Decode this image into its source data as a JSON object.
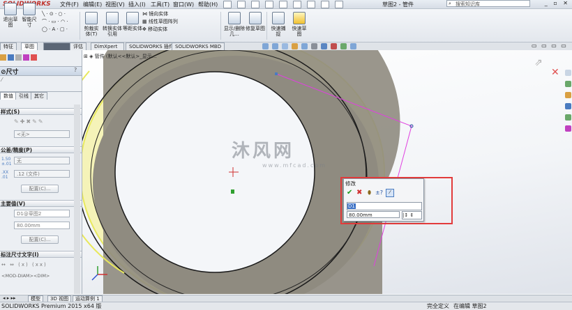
{
  "app": {
    "logo": "SOLIDWORKS",
    "doc_title": "草图2 - 管件",
    "search_placeholder": "搜索知识库",
    "window_controls": "_ ▫ ✕"
  },
  "menu": [
    "文件(F)",
    "编辑(E)",
    "视图(V)",
    "插入(I)",
    "工具(T)",
    "窗口(W)",
    "帮助(H)"
  ],
  "ribbon": {
    "exit_sketch": "退出草图",
    "smart_dim": "智能尺寸",
    "trim": "剪裁实体(T)",
    "convert": "转换实体引用",
    "offset": "等距实体",
    "mirror": "镜向实体",
    "linear_pattern": "线性草图阵列",
    "move": "移动实体",
    "display_relations": "显示/删除几...",
    "repair": "修复草图",
    "quick_snaps": "快速捕捉",
    "rapid_sketch": "快速草图"
  },
  "tabs": [
    "特征",
    "草图",
    "评估",
    "DimXpert",
    "SOLIDWORKS 插件",
    "SOLIDWORKS MBD"
  ],
  "tree_header": "管件 (默认<<默认>_显示...",
  "panel": {
    "title": "尺寸",
    "help": "?",
    "subtabs": [
      "数值",
      "引线",
      "其它"
    ],
    "style_header": "样式(S)",
    "style_value": "<无>",
    "tolerance_header": "公差/精度(P)",
    "tol_type": "无",
    "precision": ".12 (文件)",
    "config_button": "配置(C)...",
    "primary_header": "主要值(V)",
    "primary_name": "D1@草图2",
    "primary_value": "80.00mm",
    "config_button2": "配置(C)...",
    "dimtext_header": "标注尺寸文字(I)",
    "dimtext_value": "<MOD-DIAM><DIM>"
  },
  "modify": {
    "title": "修改",
    "name": "D1",
    "value": "80.00mm"
  },
  "watermark": {
    "main": "沐风网",
    "sub": "www.mfcad.com"
  },
  "bottom_tabs": [
    "模型",
    "3D 视图",
    "运动算例 1"
  ],
  "status": {
    "product": "SOLIDWORKS Premium 2015 x64 版",
    "state": "完全定义",
    "editing": "在编辑 草图2"
  },
  "colors": {
    "ring_fill": "#f5f3b8",
    "ring_edge": "#e8e85c",
    "ring_dark": "#8f8b80",
    "sketch_line": "#e040e0",
    "red_highlight": "#e23b3b",
    "accent": "#c0302a"
  }
}
